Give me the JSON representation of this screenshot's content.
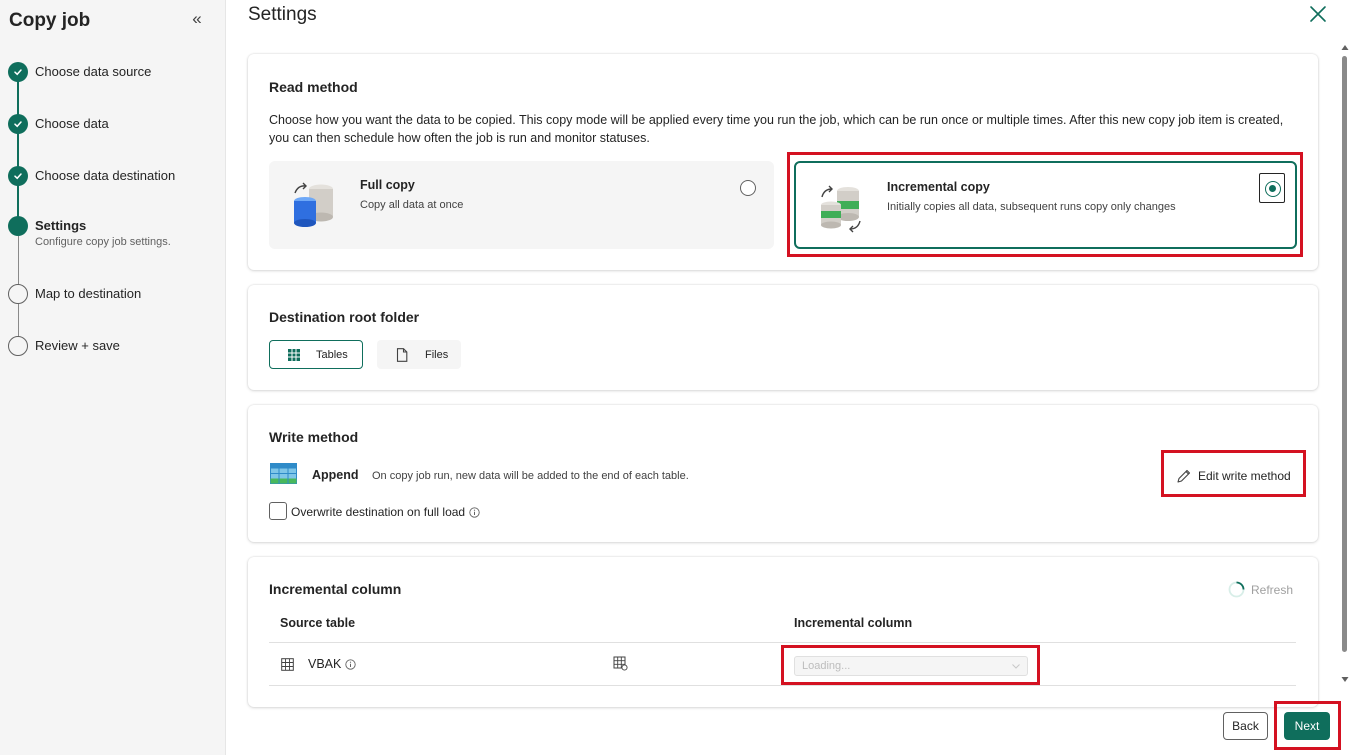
{
  "sidebar": {
    "title": "Copy job",
    "collapse_glyph": "«",
    "steps": [
      {
        "label": "Choose data source",
        "state": "done"
      },
      {
        "label": "Choose data",
        "state": "done"
      },
      {
        "label": "Choose data destination",
        "state": "done"
      },
      {
        "label": "Settings",
        "sub": "Configure copy job settings.",
        "state": "current"
      },
      {
        "label": "Map to destination",
        "state": "todo"
      },
      {
        "label": "Review + save",
        "state": "todo"
      }
    ]
  },
  "main": {
    "title": "Settings",
    "read_method": {
      "title": "Read method",
      "description": "Choose how you want the data to be copied. This copy mode will be applied every time you run the job, which can be run once or multiple times. After this new copy job item is created, you can then schedule how often the job is run and monitor statuses.",
      "options": [
        {
          "title": "Full copy",
          "subtitle": "Copy all data at once",
          "selected": false
        },
        {
          "title": "Incremental copy",
          "subtitle": "Initially copies all data, subsequent runs copy only changes",
          "selected": true
        }
      ]
    },
    "destination_root": {
      "title": "Destination root folder",
      "options": [
        {
          "label": "Tables",
          "selected": true
        },
        {
          "label": "Files",
          "selected": false
        }
      ]
    },
    "write_method": {
      "title": "Write method",
      "mode": "Append",
      "mode_description": "On copy job run, new data will be added to the end of each table.",
      "edit_label": "Edit write method",
      "overwrite_label": "Overwrite destination on full load",
      "overwrite_checked": false
    },
    "incremental_column": {
      "title": "Incremental column",
      "refresh_label": "Refresh",
      "columns": [
        "Source table",
        "Incremental column"
      ],
      "rows": [
        {
          "source_table": "VBAK",
          "incremental_column": "Loading..."
        }
      ]
    }
  },
  "footer": {
    "back_label": "Back",
    "next_label": "Next"
  },
  "colors": {
    "accent": "#0f6e5c",
    "highlight": "#d41121"
  },
  "icons": [
    "chevron-double-left-icon",
    "checkmark-icon",
    "close-icon",
    "full-copy-db-icon",
    "incremental-copy-db-icon",
    "table-grid-icon",
    "document-icon",
    "append-table-icon",
    "pencil-icon",
    "info-icon",
    "spinner-icon",
    "table-icon",
    "table-settings-icon",
    "chevron-down-icon"
  ]
}
